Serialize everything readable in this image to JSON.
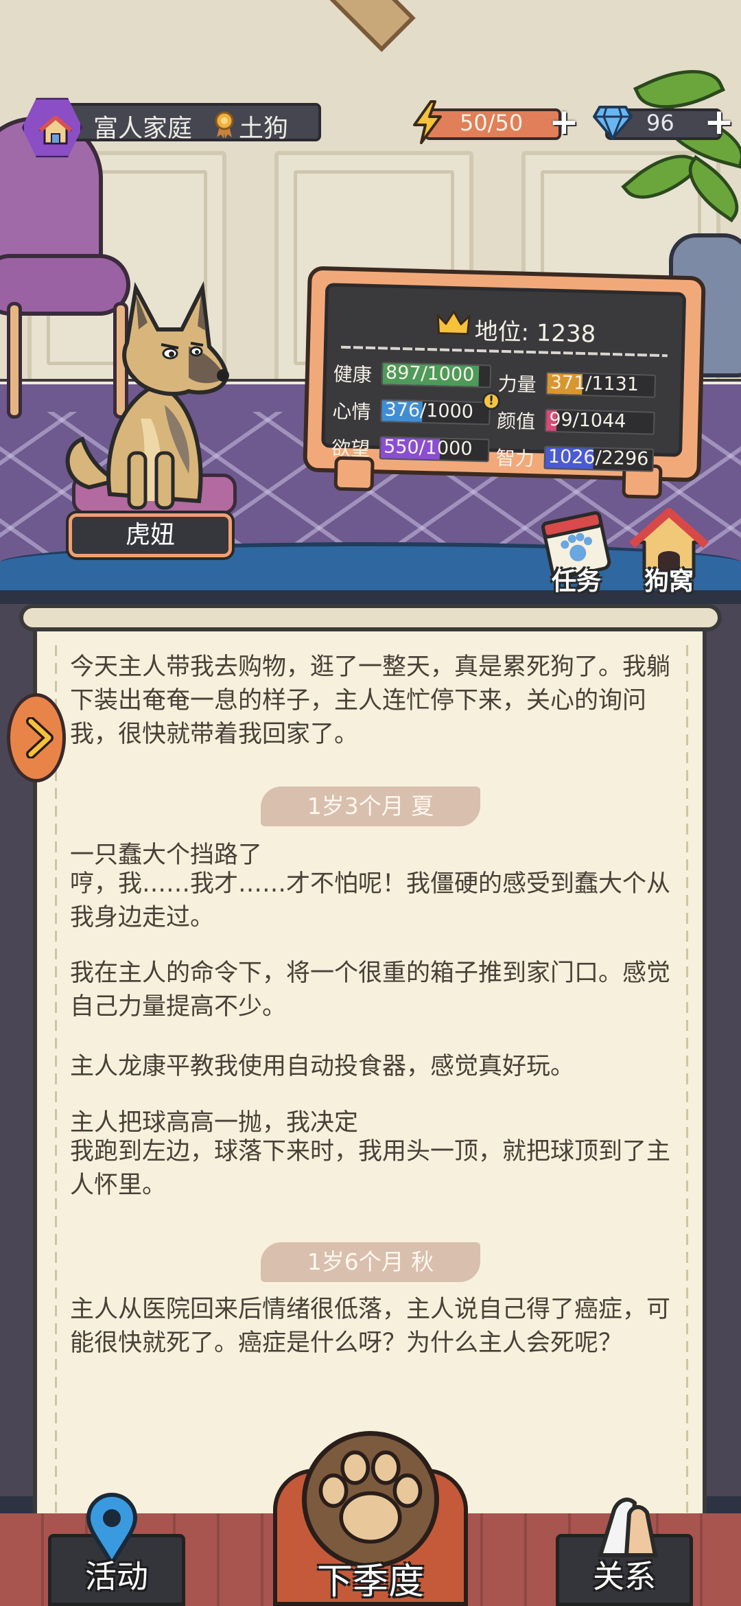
{
  "hud": {
    "family": "富人家庭",
    "breed": "土狗",
    "energy": "50/50",
    "gems": "96"
  },
  "pet": {
    "name": "虎妞"
  },
  "board": {
    "status": "地位: 1238",
    "stats": [
      {
        "name": "健康",
        "value": "897/1000",
        "fraction": 0.897,
        "color": "#4f9a5a"
      },
      {
        "name": "力量",
        "value": "371/1131",
        "fraction": 0.33,
        "color": "#d8962f"
      },
      {
        "name": "心情",
        "value": "376/1000",
        "fraction": 0.376,
        "color": "#3f8ed4"
      },
      {
        "name": "颜值",
        "value": "99/1044",
        "fraction": 0.095,
        "color": "#d64a7a"
      },
      {
        "name": "欲望",
        "value": "550/1000",
        "fraction": 0.55,
        "color": "#8a4ed2"
      },
      {
        "name": "智力",
        "value": "1026/2296",
        "fraction": 0.447,
        "color": "#4a5ad2"
      }
    ]
  },
  "quick": {
    "task": "任务",
    "kennel": "狗窝"
  },
  "story": {
    "p1": "今天主人带我去购物，逛了一整天，真是累死狗了。我躺下装出奄奄一息的样子，主人连忙停下来，关心的询问我，很快就带着我回家了。",
    "season1": "1岁3个月 夏",
    "p2a": "一只蠢大个挡路了",
    "p2b": "哼，我……我才……才不怕呢！我僵硬的感受到蠢大个从我身边走过。",
    "p3": "我在主人的命令下，将一个很重的箱子推到家门口。感觉自己力量提高不少。",
    "p4": "主人龙康平教我使用自动投食器，感觉真好玩。",
    "p5a": "主人把球高高一抛，我决定",
    "p5b": "我跑到左边，球落下来时，我用头一顶，就把球顶到了主人怀里。",
    "season2": "1岁6个月 秋",
    "p6": "主人从医院回来后情绪很低落，主人说自己得了癌症，可能很快就死了。癌症是什么呀？为什么主人会死呢？"
  },
  "nav": {
    "activity": "活动",
    "next_season": "下季度",
    "relations": "关系"
  }
}
